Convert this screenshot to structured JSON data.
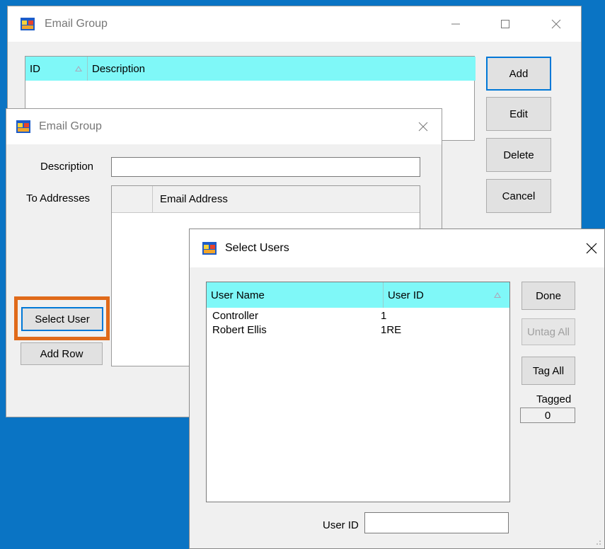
{
  "back_window": {
    "title": "Email Group",
    "grid_headers": [
      "ID",
      "Description"
    ],
    "buttons": {
      "add": "Add",
      "edit": "Edit",
      "delete": "Delete",
      "cancel": "Cancel"
    }
  },
  "middle_window": {
    "title": "Email Group",
    "description_label": "Description",
    "description_value": "",
    "to_addresses_label": "To Addresses",
    "grid_header_email": "Email Address",
    "select_user_label": "Select User",
    "add_row_label": "Add Row"
  },
  "front_window": {
    "title": "Select Users",
    "headers": {
      "user_name": "User Name",
      "user_id": "User ID"
    },
    "rows": [
      {
        "user_name": "Controller",
        "user_id": "1"
      },
      {
        "user_name": "Robert Ellis",
        "user_id": "1RE"
      }
    ],
    "buttons": {
      "done": "Done",
      "untag_all": "Untag All",
      "tag_all": "Tag All"
    },
    "tagged_label": "Tagged",
    "tagged_count": "0",
    "user_id_label": "User ID",
    "user_id_value": ""
  },
  "colors": {
    "desktop": "#0a74c4",
    "grid_header": "#7ff8f8",
    "highlight_border": "#e06a1a",
    "default_button_border": "#0078d7"
  },
  "icons": {
    "app": "app-window-icon",
    "minimize": "minimize-icon",
    "maximize": "maximize-icon",
    "close": "close-icon",
    "sort": "sort-ascending-icon"
  }
}
